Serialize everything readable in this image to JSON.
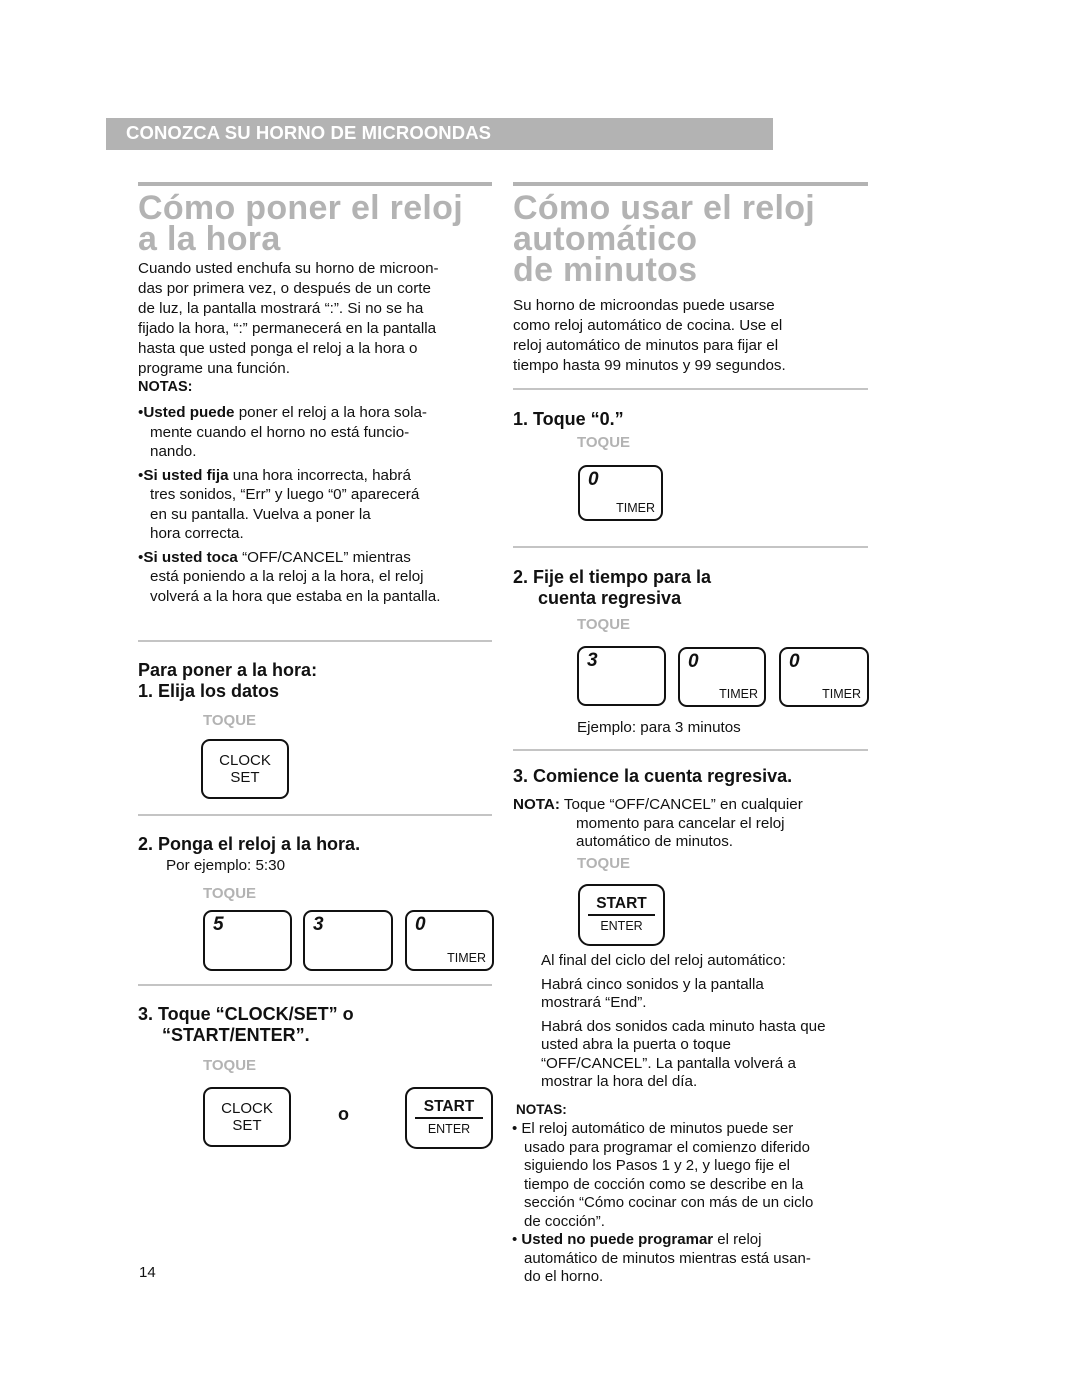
{
  "section_header": "CONOZCA SU HORNO DE MICROONDAS",
  "left": {
    "title_line1": "Cómo poner el reloj",
    "title_line2": "a la hora",
    "intro": [
      "Cuando usted enchufa su horno de microon-",
      "das por primera vez, o después de un corte",
      "de luz, la pantalla mostrará “:”. Si no se ha",
      "fijado la hora, “:” permanecerá en la pantalla",
      "hasta que usted ponga el reloj a la hora o",
      "programe una función."
    ],
    "notas_heading": "NOTAS:",
    "notes": [
      {
        "bold": "Usted puede",
        "lines": [
          " poner el reloj a la hora sola-",
          "mente cuando el horno no está funcio-",
          "nando."
        ]
      },
      {
        "bold": "Si usted fija",
        "lines": [
          " una hora incorrecta, habrá",
          "tres sonidos, “Err”  y luego “0” aparecerá",
          "en su pantalla. Vuelva a poner la",
          "hora correcta."
        ]
      },
      {
        "bold": "Si usted toca",
        "lines": [
          " “OFF/CANCEL” mientras",
          "está poniendo a la reloj a la hora, el reloj",
          "volverá a la hora que estaba en la pantalla."
        ]
      }
    ],
    "step1": {
      "line1": "Para poner a la hora:",
      "line2": "1. Elija los datos",
      "toque": "TOQUE",
      "key": {
        "line1": "CLOCK",
        "line2": "SET"
      }
    },
    "step2": {
      "title": "2. Ponga el reloj a la hora.",
      "example": "Por ejemplo: 5:30",
      "toque": "TOQUE",
      "keys": [
        {
          "num": "5",
          "sub": ""
        },
        {
          "num": "3",
          "sub": ""
        },
        {
          "num": "0",
          "sub": "TIMER"
        }
      ]
    },
    "step3": {
      "line1": "3. Toque “CLOCK/SET” o",
      "line2": "“START/ENTER”.",
      "toque": "TOQUE",
      "key_clock": {
        "line1": "CLOCK",
        "line2": "SET"
      },
      "or": "o",
      "key_start": {
        "top": "START",
        "bottom": "ENTER"
      }
    },
    "page_number": "14"
  },
  "right": {
    "title_line1": "Cómo usar el reloj",
    "title_line2": "automático",
    "title_line3": "de minutos",
    "intro": [
      "Su horno de microondas puede usarse",
      "como reloj automático de cocina. Use el",
      "reloj automático de minutos para fijar el",
      "tiempo hasta 99 minutos y 99 segundos."
    ],
    "step1": {
      "title": "1. Toque “0.”",
      "toque": "TOQUE",
      "key": {
        "num": "0",
        "sub": "TIMER"
      }
    },
    "step2": {
      "line1": "2. Fije el tiempo para la",
      "line2": "cuenta regresiva",
      "toque": "TOQUE",
      "keys": [
        {
          "num": "3",
          "sub": ""
        },
        {
          "num": "0",
          "sub": "TIMER"
        },
        {
          "num": "0",
          "sub": "TIMER"
        }
      ],
      "example": "Ejemplo: para 3 minutos"
    },
    "step3": {
      "title": "3. Comience la cuenta regresiva.",
      "nota_label": "NOTA:",
      "nota_lines": [
        " Toque “OFF/CANCEL” en cualquier",
        "momento para cancelar el reloj",
        "automático de minutos."
      ],
      "toque": "TOQUE",
      "key_start": {
        "top": "START",
        "bottom": "ENTER"
      }
    },
    "end_info": {
      "heading": "Al final del ciclo del reloj automático:",
      "para1": [
        "Habrá cinco sonidos y la pantalla",
        "mostrará “End”."
      ],
      "para2": [
        "Habrá dos sonidos cada minuto hasta que",
        "usted abra la puerta o toque",
        "“OFF/CANCEL”. La pantalla volverá a",
        "mostrar la hora del día."
      ]
    },
    "notas_heading": "NOTAS:",
    "notes": [
      {
        "bold": "",
        "lines": [
          "El reloj automático de minutos puede ser",
          "usado para programar el comienzo diferido",
          "siguiendo los Pasos 1 y 2, y luego fije el",
          "tiempo de cocción como se describe en la",
          "sección “Cómo cocinar con más de un ciclo",
          "de cocción”."
        ]
      },
      {
        "bold": "Usted no puede programar",
        "lines": [
          " el reloj",
          "automático de minutos mientras está usan-",
          "do el horno."
        ]
      }
    ]
  }
}
